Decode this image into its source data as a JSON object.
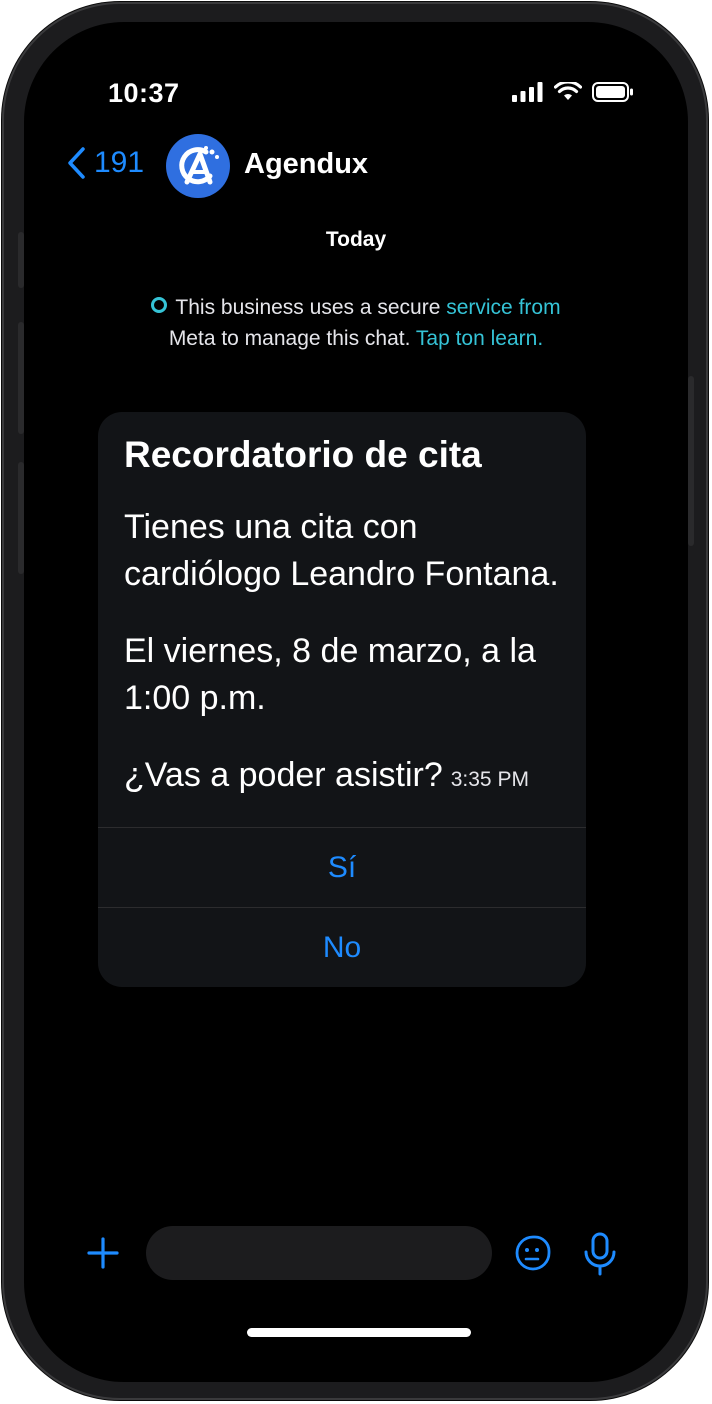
{
  "status_bar": {
    "time": "10:37"
  },
  "nav": {
    "back_count": "191",
    "contact_name": "Agendux",
    "avatar_icon": "agendux-logo-icon",
    "accent_color": "#1e8bff"
  },
  "chat": {
    "date_label": "Today",
    "meta_notice": {
      "part1": "This business uses a secure ",
      "link1": "service from",
      "part2": " Meta to manage this chat. ",
      "link2": "Tap ton learn."
    }
  },
  "message": {
    "title": "Recordatorio de cita",
    "para1": "Tienes una cita con cardiólogo Leandro Fontana.",
    "para2": "El viernes, 8 de marzo, a la 1:00 p.m.",
    "question": "¿Vas a poder asistir?",
    "time": "3:35 PM",
    "replies": [
      "Sí",
      "No"
    ]
  },
  "composer": {
    "placeholder": "",
    "icons": [
      "plus-icon",
      "sticker-icon",
      "microphone-icon"
    ]
  }
}
